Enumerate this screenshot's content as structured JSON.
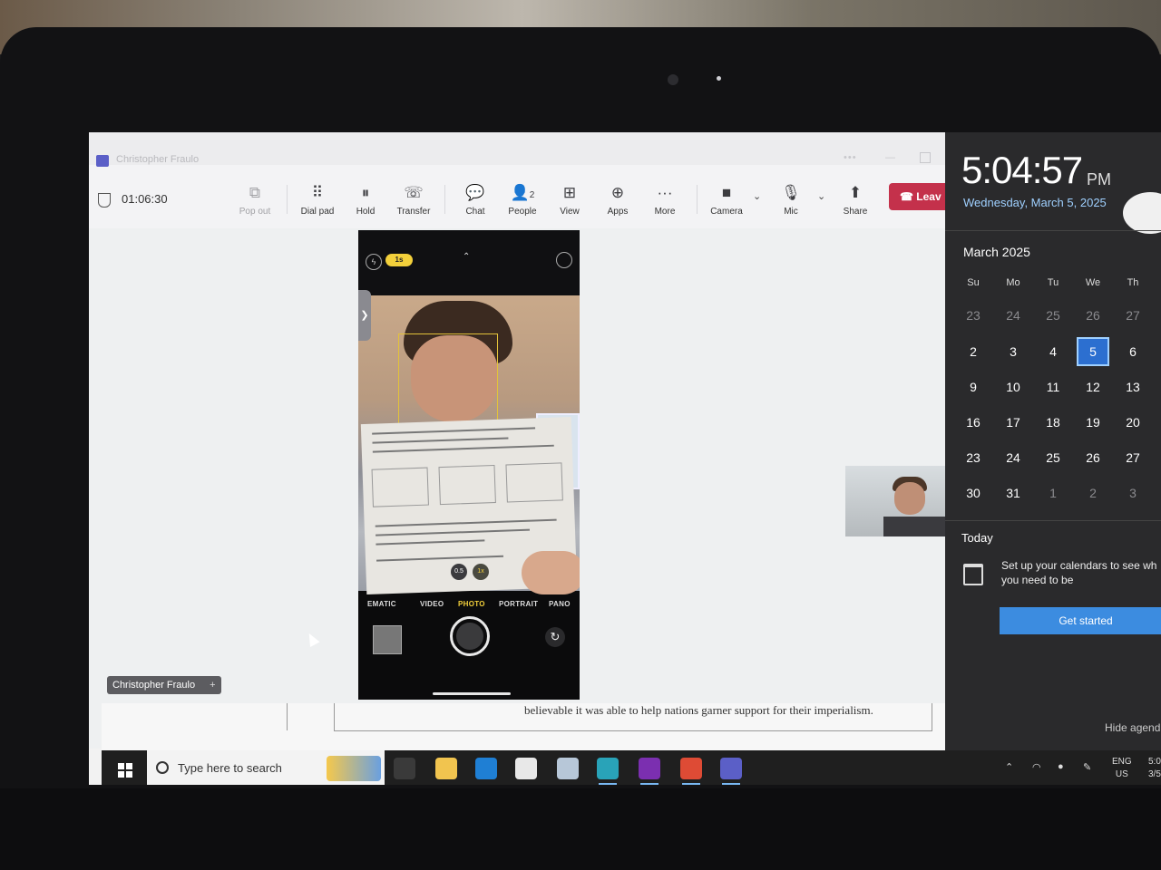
{
  "teams": {
    "window_title": "Christopher Fraulo",
    "call_timer": "01:06:30",
    "toolbar": {
      "pop_out": "Pop out",
      "dial_pad": "Dial pad",
      "hold": "Hold",
      "transfer": "Transfer",
      "chat": "Chat",
      "people": "People",
      "people_count": "2",
      "view": "View",
      "apps": "Apps",
      "more": "More",
      "camera": "Camera",
      "mic": "Mic",
      "share": "Share",
      "leave": "Leav"
    },
    "participant_name": "Christopher Fraulo"
  },
  "phone_camera": {
    "live_badge": "1s",
    "modes": [
      "EMATIC",
      "VIDEO",
      "PHOTO",
      "PORTRAIT",
      "PANO"
    ],
    "active_mode": "PHOTO",
    "zoom_levels": [
      "0.5",
      "1x"
    ]
  },
  "document": {
    "text": "believable it was able to help nations garner support for their imperialism."
  },
  "taskbar": {
    "search_placeholder": "Type here to search",
    "language": "ENG",
    "region": "US",
    "clock_time": "5:0",
    "clock_date": "3/5"
  },
  "calendar": {
    "time": "5:04:57",
    "ampm": "PM",
    "long_date": "Wednesday, March 5, 2025",
    "month_label": "March 2025",
    "weekdays": [
      "Su",
      "Mo",
      "Tu",
      "We",
      "Th"
    ],
    "weeks": [
      [
        "23",
        "24",
        "25",
        "26",
        "27"
      ],
      [
        "2",
        "3",
        "4",
        "5",
        "6"
      ],
      [
        "9",
        "10",
        "11",
        "12",
        "13"
      ],
      [
        "16",
        "17",
        "18",
        "19",
        "20"
      ],
      [
        "23",
        "24",
        "25",
        "26",
        "27"
      ],
      [
        "30",
        "31",
        "1",
        "2",
        "3"
      ]
    ],
    "today_heading": "Today",
    "setup_text": "Set up your calendars to see wh you need to be",
    "get_started": "Get started",
    "hide_agenda": "Hide agend"
  }
}
